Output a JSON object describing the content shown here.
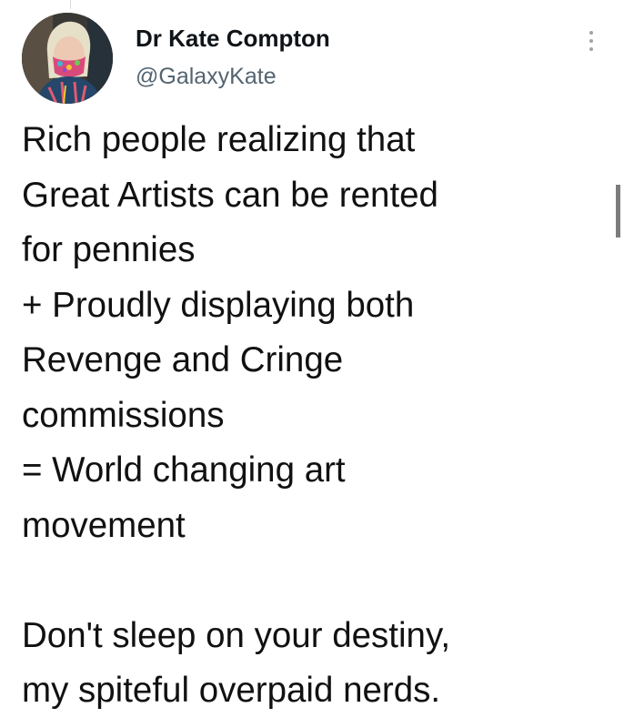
{
  "tweet": {
    "author": {
      "display_name": "Dr Kate Compton",
      "handle": "@GalaxyKate"
    },
    "avatar_icon": "profile-photo-avatar",
    "more_icon": "more-options-icon",
    "text_lines": [
      "Rich people realizing that",
      "Great Artists can be rented",
      "for pennies",
      "+ Proudly displaying both",
      "Revenge and Cringe",
      "commissions",
      "= World changing art",
      "movement",
      "",
      "Don't sleep on your destiny,",
      "my spiteful overpaid nerds."
    ]
  },
  "colors": {
    "text": "#0f1419",
    "handle": "#536471",
    "background": "#ffffff"
  }
}
